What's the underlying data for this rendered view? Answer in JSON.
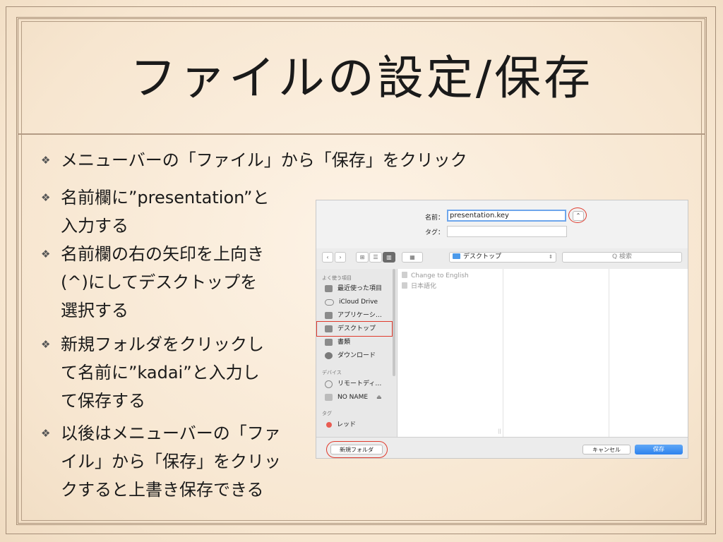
{
  "slide": {
    "title": "ファイルの設定/保存",
    "bullet_mark": "❖",
    "main_bullet": "メニューバーの「ファイル」から「保存」をクリック",
    "bullets": [
      [
        "名前欄に”presentation”と",
        "入力する"
      ],
      [
        "名前欄の右の矢印を上向き",
        "(^)にしてデスクトップを",
        "選択する"
      ],
      [
        "新規フォルダをクリックし",
        "て名前に”kadai”と入力し",
        "て保存する"
      ],
      [
        "以後はメニューバーの「ファ",
        "イル」から「保存」をクリッ",
        "クすると上書き保存できる"
      ]
    ]
  },
  "dialog": {
    "name_label": "名前：",
    "name_value": "presentation.key",
    "tag_label": "タグ：",
    "expand_glyph": "⌃",
    "toolbar": {
      "back": "‹",
      "forward": "›",
      "view_icons": "⊞",
      "view_list": "☰",
      "view_columns": "▥",
      "view_gallery": "▦",
      "location": "デスクトップ",
      "search_placeholder": "Q 検索"
    },
    "sidebar": {
      "favorites_header": "よく使う項目",
      "favorites": [
        "最近使った項目",
        "iCloud Drive",
        "アプリケーシ…",
        "デスクトップ",
        "書類",
        "ダウンロード"
      ],
      "devices_header": "デバイス",
      "devices": [
        "リモートディ…",
        "NO NAME"
      ],
      "eject_glyph": "⏏",
      "tags_header": "タグ",
      "tags": [
        "レッド"
      ]
    },
    "files": [
      "Change to English",
      "日本語化"
    ],
    "buttons": {
      "new_folder": "新規フォルダ",
      "cancel": "キャンセル",
      "save": "保存"
    },
    "highlight_color": "#e03a2c",
    "accent_color": "#2d82ee"
  }
}
